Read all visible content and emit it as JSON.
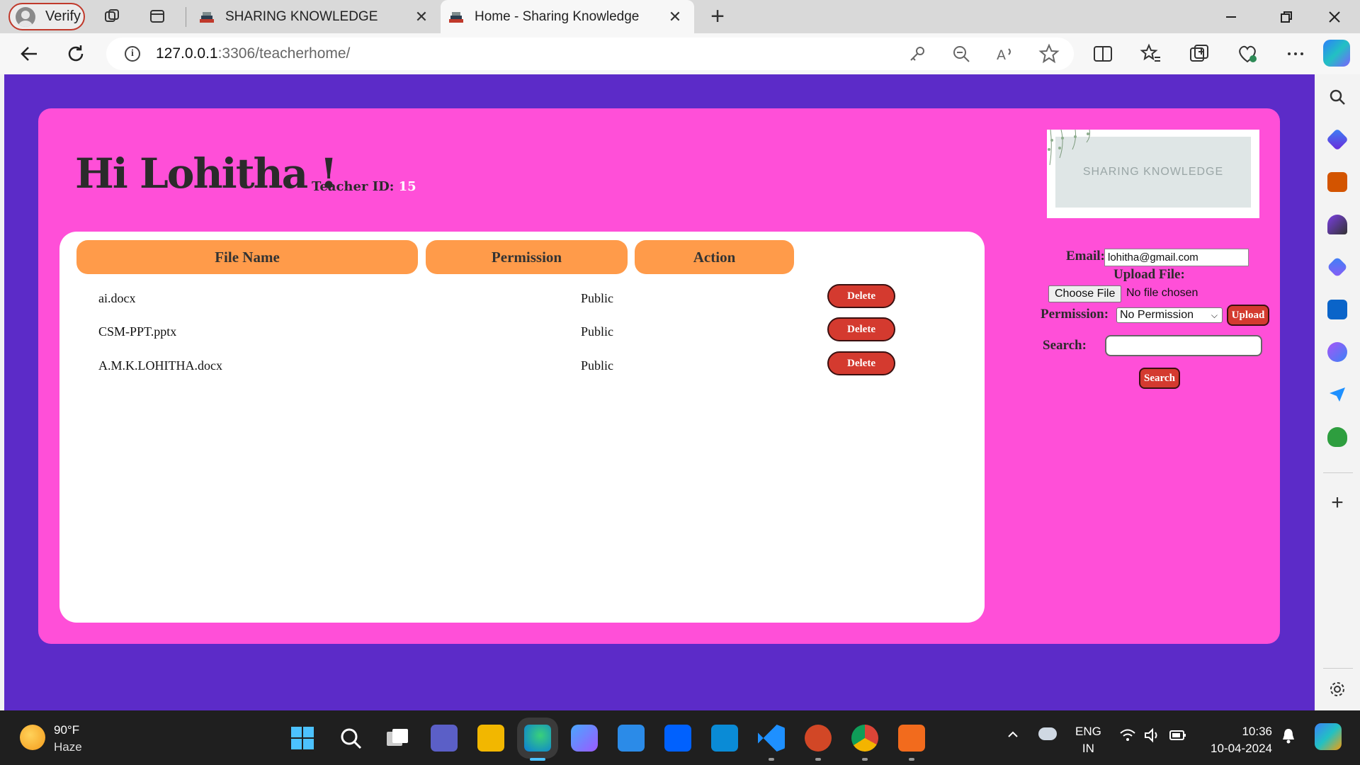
{
  "browser": {
    "profile_label": "Verify",
    "tabs": [
      {
        "title": "SHARING KNOWLEDGE",
        "active": false
      },
      {
        "title": "Home - Sharing Knowledge",
        "active": true
      }
    ],
    "close_glyph": "✕",
    "new_tab_glyph": "+",
    "url_host": "127.0.0.1",
    "url_path": ":3306/teacherhome/",
    "info_glyph": "i"
  },
  "page": {
    "greeting": "Hi Lohitha !",
    "teacher_id_label": "Teacher ID:",
    "teacher_id_value": "15",
    "logo_text": "SHARING KNOWLEDGE",
    "table": {
      "headers": [
        "File Name",
        "Permission",
        "Action"
      ],
      "rows": [
        {
          "name": "ai.docx",
          "permission": "Public",
          "action": "Delete"
        },
        {
          "name": "CSM-PPT.pptx",
          "permission": "Public",
          "action": "Delete"
        },
        {
          "name": "A.M.K.LOHITHA.docx",
          "permission": "Public",
          "action": "Delete"
        }
      ]
    },
    "form": {
      "email_label": "Email:",
      "email_value": "lohitha@gmail.com",
      "upload_label": "Upload File:",
      "choose_file": "Choose File",
      "no_file": "No file chosen",
      "permission_label": "Permission:",
      "permission_value": "No Permission",
      "upload_button": "Upload",
      "search_label": "Search:",
      "search_value": "",
      "search_button": "Search"
    }
  },
  "taskbar": {
    "weather_temp": "90°F",
    "weather_desc": "Haze",
    "lang_top": "ENG",
    "lang_bottom": "IN",
    "time": "10:36",
    "date": "10-04-2024"
  },
  "colors": {
    "viewport_bg": "#5c2bc8",
    "card_bg": "#ff4fd8",
    "header_cell": "#ff9b4a",
    "button_red": "#d43a2f"
  }
}
